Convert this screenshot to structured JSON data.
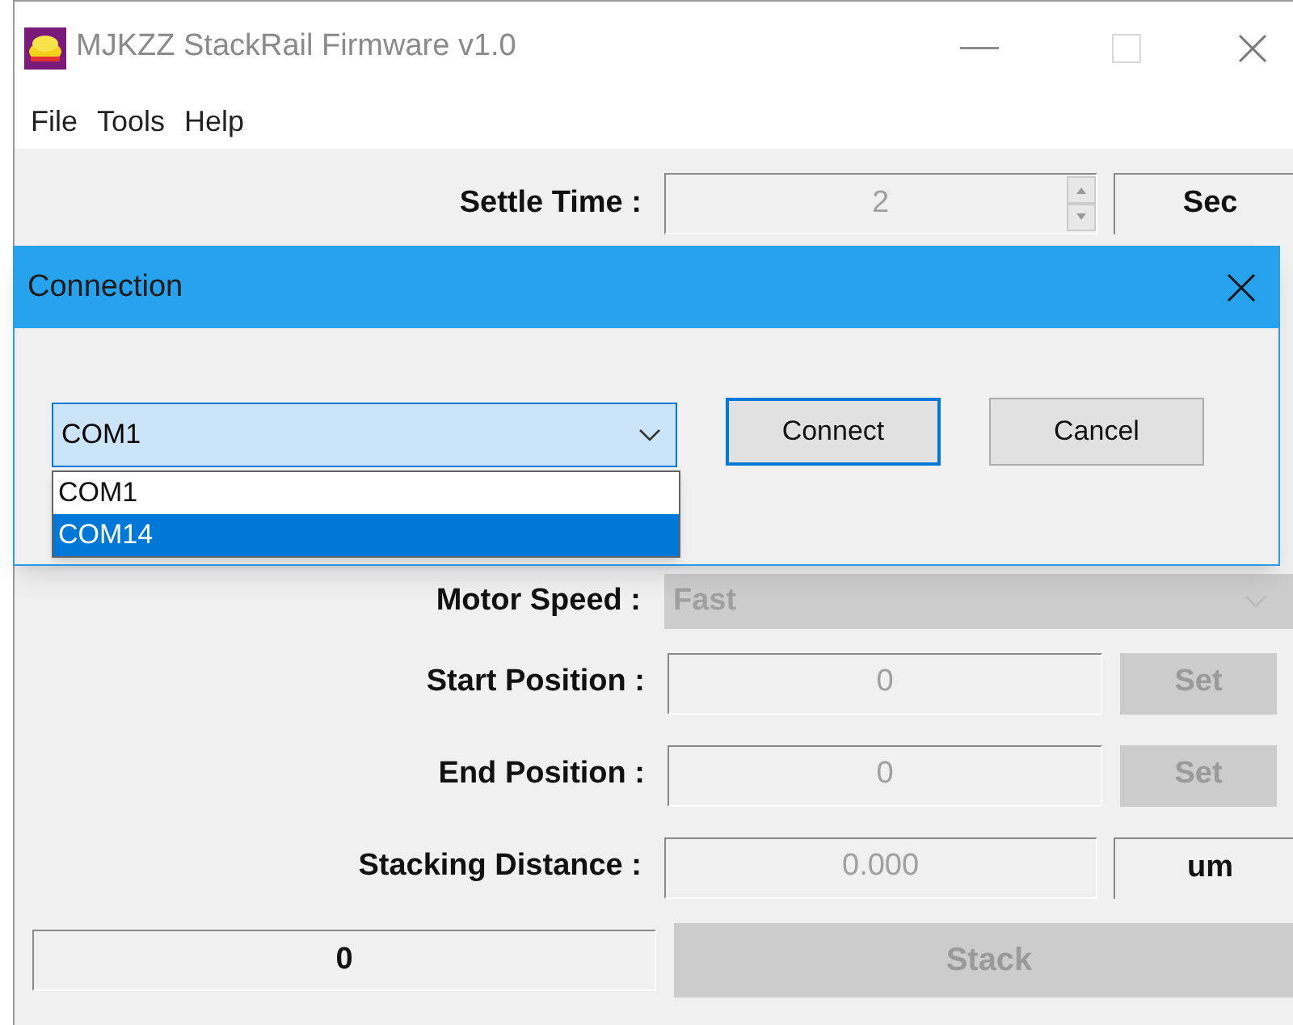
{
  "window": {
    "title": "MJKZZ StackRail Firmware v1.0"
  },
  "menu": [
    "File",
    "Tools",
    "Help"
  ],
  "fields": [
    {
      "kind": "spin",
      "label": "Settle Time :",
      "value": "2",
      "unit": "Sec",
      "disabled": true
    },
    {
      "kind": "combo",
      "label": "Motor Speed :",
      "value": "Fast",
      "disabled": true
    },
    {
      "kind": "set",
      "label": "Start Position :",
      "value": "0",
      "button": "Set",
      "disabled": true
    },
    {
      "kind": "set",
      "label": "End Position :",
      "value": "0",
      "button": "Set",
      "disabled": true
    },
    {
      "kind": "unit",
      "label": "Stacking Distance :",
      "value": "0.000",
      "unit": "um",
      "disabled": true
    }
  ],
  "counter": "0",
  "stack_button": {
    "label": "Stack",
    "disabled": true
  },
  "dialog": {
    "title": "Connection",
    "port": "COM1",
    "options": [
      {
        "label": "COM1",
        "selected": false
      },
      {
        "label": "COM14",
        "selected": true
      }
    ],
    "buttons": [
      {
        "label": "Connect",
        "default": true
      },
      {
        "label": "Cancel",
        "default": false
      }
    ]
  }
}
